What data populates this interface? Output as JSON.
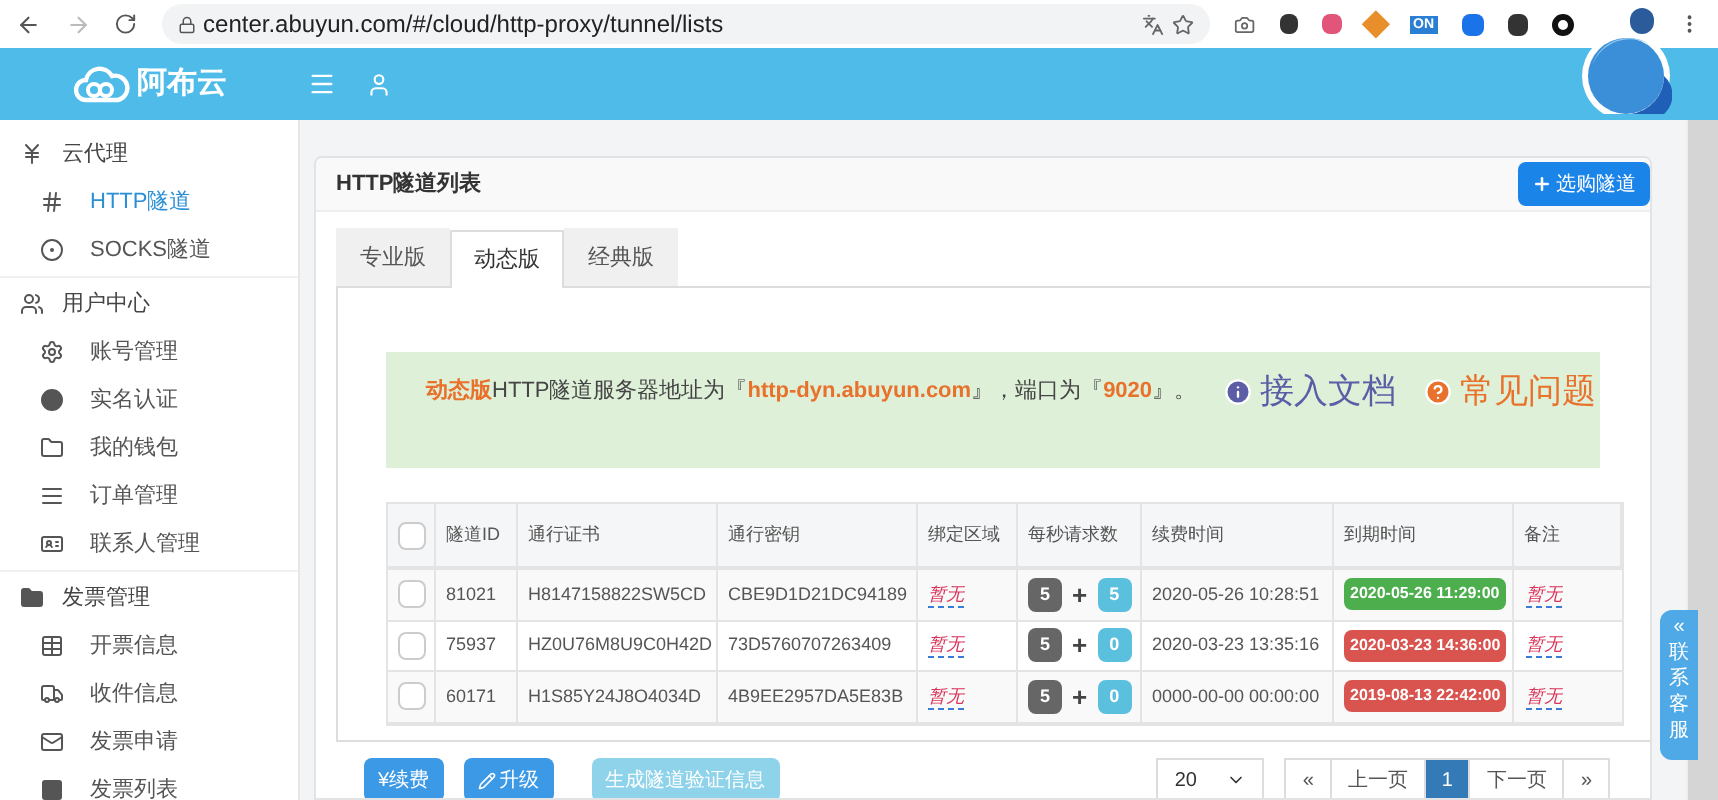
{
  "browser": {
    "url": "center.abuyun.com/#/cloud/http-proxy/tunnel/lists",
    "extension_badge": "ON"
  },
  "header": {
    "logo": "阿布云"
  },
  "sidebar": {
    "groups": [
      {
        "label": "云代理",
        "children": [
          {
            "label": "HTTP隧道",
            "selected": true
          },
          {
            "label": "SOCKS隧道",
            "selected": false
          }
        ]
      },
      {
        "label": "用户中心",
        "children": [
          {
            "label": "账号管理",
            "selected": false
          },
          {
            "label": "实名认证",
            "selected": false
          },
          {
            "label": "我的钱包",
            "selected": false
          },
          {
            "label": "订单管理",
            "selected": false
          },
          {
            "label": "联系人管理",
            "selected": false
          }
        ]
      },
      {
        "label": "发票管理",
        "children": [
          {
            "label": "开票信息",
            "selected": false
          },
          {
            "label": "收件信息",
            "selected": false
          },
          {
            "label": "发票申请",
            "selected": false
          },
          {
            "label": "发票列表",
            "selected": false
          }
        ]
      }
    ]
  },
  "card": {
    "title": "HTTP隧道列表",
    "buy_button": "选购隧道"
  },
  "tabs": [
    {
      "label": "专业版",
      "selected": false
    },
    {
      "label": "动态版",
      "selected": true
    },
    {
      "label": "经典版",
      "selected": false
    }
  ],
  "alert": {
    "text": "**动态版**HTTP隧道服务器地址为『**http-dyn.abuyun.com**』，端口为『**9020**』。",
    "links": [
      {
        "label": "接入文档",
        "kind": "info"
      },
      {
        "label": "常见问题",
        "kind": "help"
      }
    ]
  },
  "table": {
    "header_checked": false,
    "columns": [
      "隧道ID",
      "通行证书",
      "通行密钥",
      "绑定区域",
      "每秒请求数",
      "续费时间",
      "到期时间",
      "备注"
    ],
    "rows": [
      {
        "checked": false,
        "id": "81021",
        "cert": "H8147158822SW5CD",
        "key": "CBE9D1D21DC94189",
        "region": "暂无",
        "base": "5",
        "plus": "+",
        "extra": "5",
        "renew": "2020-05-26 10:28:51",
        "expire": "2020-05-26 11:29:00",
        "color": "#4cae4c",
        "note": "暂无"
      },
      {
        "checked": false,
        "id": "75937",
        "cert": "HZ0U76M8U9C0H42D",
        "key": "73D5760707263409",
        "region": "暂无",
        "base": "5",
        "plus": "+",
        "extra": "0",
        "renew": "2020-03-23 13:35:16",
        "expire": "2020-03-23 14:36:00",
        "color": "#d9534f",
        "note": "暂无"
      },
      {
        "checked": false,
        "id": "60171",
        "cert": "H1S85Y24J8O4034D",
        "key": "4B9EE2957DA5E83B",
        "region": "暂无",
        "base": "5",
        "plus": "+",
        "extra": "0",
        "renew": "0000-00-00 00:00:00",
        "expire": "2019-08-13 22:42:00",
        "color": "#d9534f",
        "note": "暂无"
      }
    ]
  },
  "actions": [
    {
      "label": "¥续费",
      "disabled": false
    },
    {
      "label": "升级",
      "kind": "edit",
      "disabled": false
    },
    {
      "label": "生成隧道验证信息",
      "disabled": true
    }
  ],
  "page_size": "20",
  "pagination": [
    {
      "label": "«",
      "selected": false
    },
    {
      "label": "上一页",
      "selected": false
    },
    {
      "label": "1",
      "selected": true
    },
    {
      "label": "下一页",
      "selected": false
    },
    {
      "label": "»",
      "selected": false
    }
  ],
  "contact": {
    "arrow": "«",
    "label": "联系客服"
  }
}
